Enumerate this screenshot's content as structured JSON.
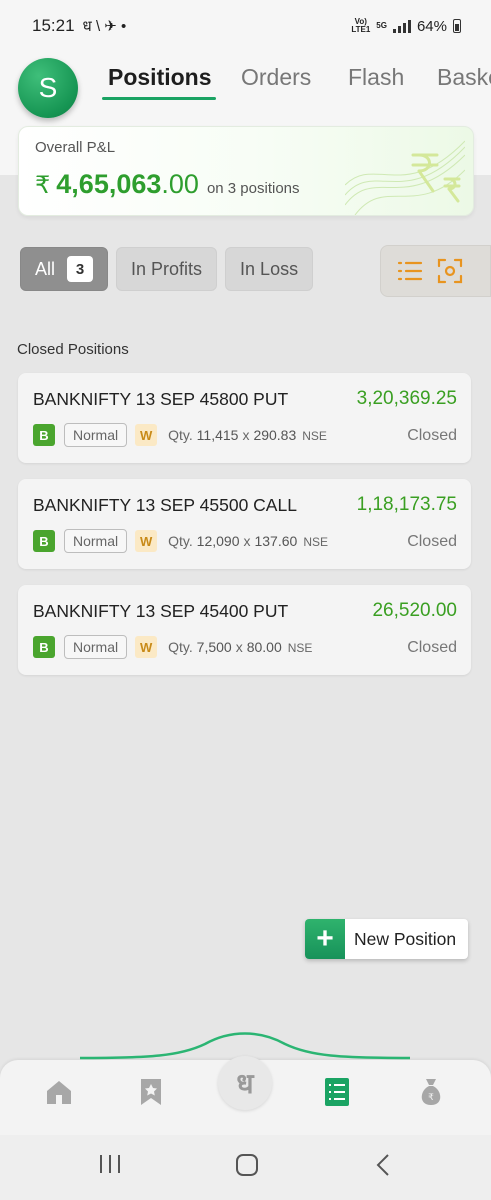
{
  "status_bar": {
    "time": "15:21",
    "left_icons_text": "ध \\ ✈ •",
    "network_top": "Vo)",
    "network_bottom": "LTE1",
    "net_type": "5G",
    "battery": "64%"
  },
  "header": {
    "avatar_letter": "S",
    "tabs": [
      {
        "label": "Positions",
        "active": true
      },
      {
        "label": "Orders",
        "active": false
      },
      {
        "label": "Flash",
        "active": false
      },
      {
        "label": "Baske",
        "active": false
      }
    ]
  },
  "pnl": {
    "title": "Overall P&L",
    "currency": "₹",
    "amount_main": "4,65,063",
    "amount_decimal": ".00",
    "suffix": "on 3 positions",
    "color": "#2e9e2e"
  },
  "filters": {
    "all_label": "All",
    "all_count": "3",
    "profits_label": "In Profits",
    "loss_label": "In Loss"
  },
  "section": {
    "closed_label": "Closed Positions"
  },
  "positions": [
    {
      "name": "BANKNIFTY 13 SEP 45800 PUT",
      "pnl": "3,20,369.25",
      "side": "B",
      "product": "Normal",
      "badge": "W",
      "qty_label": "Qty.",
      "qty": "11,415",
      "x": "x",
      "price": "290.83",
      "exchange": "NSE",
      "status": "Closed"
    },
    {
      "name": "BANKNIFTY 13 SEP 45500 CALL",
      "pnl": "1,18,173.75",
      "side": "B",
      "product": "Normal",
      "badge": "W",
      "qty_label": "Qty.",
      "qty": "12,090",
      "x": "x",
      "price": "137.60",
      "exchange": "NSE",
      "status": "Closed"
    },
    {
      "name": "BANKNIFTY 13 SEP 45400 PUT",
      "pnl": "26,520.00",
      "side": "B",
      "product": "Normal",
      "badge": "W",
      "qty_label": "Qty.",
      "qty": "7,500",
      "x": "x",
      "price": "80.00",
      "exchange": "NSE",
      "status": "Closed"
    }
  ],
  "fab": {
    "plus": "+",
    "label": "New Position"
  },
  "bottom_nav": {
    "center_glyph": "ध",
    "items": [
      "home-icon",
      "watchlist-icon",
      "positions-icon",
      "funds-icon"
    ],
    "accent": "#1aa363"
  }
}
